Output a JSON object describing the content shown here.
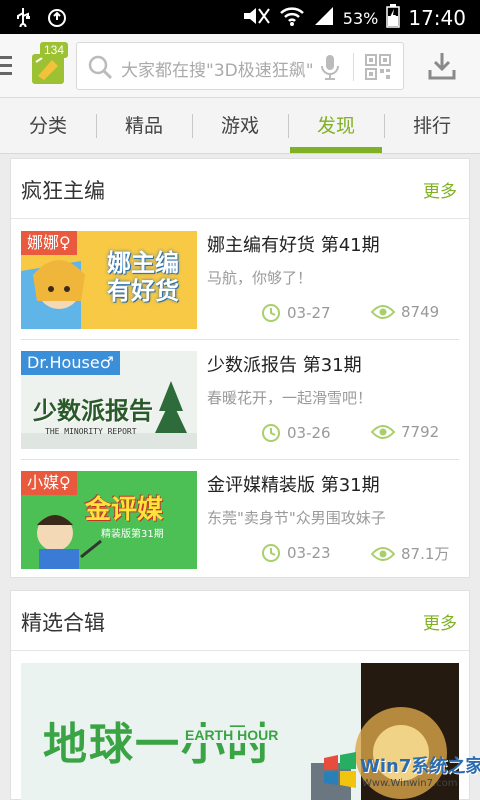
{
  "status_bar": {
    "battery": "53%",
    "time": "17:40"
  },
  "header": {
    "badge_count": "134",
    "search_placeholder": "大家都在搜\"3D极速狂飙\""
  },
  "tabs": [
    {
      "label": "分类",
      "active": false
    },
    {
      "label": "精品",
      "active": false
    },
    {
      "label": "游戏",
      "active": false
    },
    {
      "label": "发现",
      "active": true
    },
    {
      "label": "排行",
      "active": false
    }
  ],
  "section1": {
    "title": "疯狂主编",
    "more": "更多",
    "items": [
      {
        "tag": "娜娜♀",
        "tag_color": "#e8593d",
        "thumb_text": "娜主编有好货",
        "title": "娜主编有好货 第41期",
        "subtitle": "马航，你够了！",
        "date": "03-27",
        "views": "8749"
      },
      {
        "tag": "Dr.House♂",
        "tag_color": "#3a8fd8",
        "thumb_text": "少数派报告",
        "thumb_caption": "THE MINORITY REPORT",
        "title": "少数派报告 第31期",
        "subtitle": "春暖花开，一起滑雪吧！",
        "date": "03-26",
        "views": "7792"
      },
      {
        "tag": "小媒♀",
        "tag_color": "#e8593d",
        "thumb_text": "金评媒",
        "thumb_caption": "精装版第31期",
        "title": "金评媒精装版 第31期",
        "subtitle": "东莞\"卖身节\"众男围攻妹子",
        "date": "03-23",
        "views": "87.1万"
      }
    ]
  },
  "section2": {
    "title": "精选合辑",
    "more": "更多",
    "banner_title": "地球一小时",
    "banner_en": "EARTH HOUR"
  },
  "watermark": {
    "text": "Win7系统之家",
    "url": "Www.Winwin7.com"
  },
  "colors": {
    "accent": "#80b026",
    "meta_icon": "#a9cf6a"
  }
}
